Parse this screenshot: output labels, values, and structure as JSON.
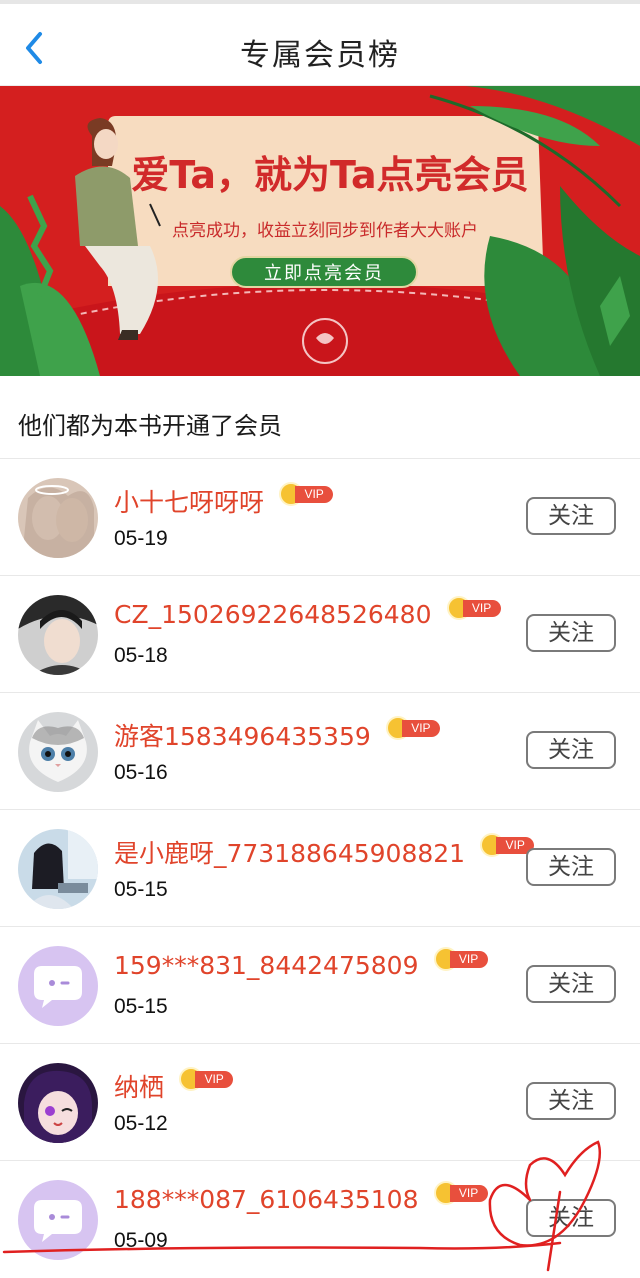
{
  "header": {
    "title": "专属会员榜",
    "back_icon": "chevron-left-icon"
  },
  "banner": {
    "headline": "爱Ta，就为Ta点亮会员",
    "subtitle": "点亮成功，收益立刻同步到作者大大账户",
    "cta_label": "立即点亮会员",
    "colors": {
      "background": "#d41f1f",
      "card": "#f7dcc0",
      "cta": "#2e8a3b"
    }
  },
  "section": {
    "title": "他们都为本书开通了会员"
  },
  "members": [
    {
      "name": "小十七呀呀呀",
      "badge": "VIP",
      "date": "05-19",
      "follow_label": "关注"
    },
    {
      "name": "CZ_15026922648526480",
      "badge": "VIP",
      "date": "05-18",
      "follow_label": "关注"
    },
    {
      "name": "游客1583496435359",
      "badge": "VIP",
      "date": "05-16",
      "follow_label": "关注"
    },
    {
      "name": "是小鹿呀_773188645908821",
      "badge": "VIP",
      "date": "05-15",
      "follow_label": "关注"
    },
    {
      "name": "159***831_8442475809",
      "badge": "VIP",
      "date": "05-15",
      "follow_label": "关注"
    },
    {
      "name": "纳栖",
      "badge": "VIP",
      "date": "05-12",
      "follow_label": "关注"
    },
    {
      "name": "188***087_6106435108",
      "badge": "VIP",
      "date": "05-09",
      "follow_label": "关注"
    }
  ],
  "colors": {
    "name": "#e0442b",
    "vip_tag": "#e84f3d",
    "crown": "#f6c232",
    "annotation": "#e02020"
  }
}
